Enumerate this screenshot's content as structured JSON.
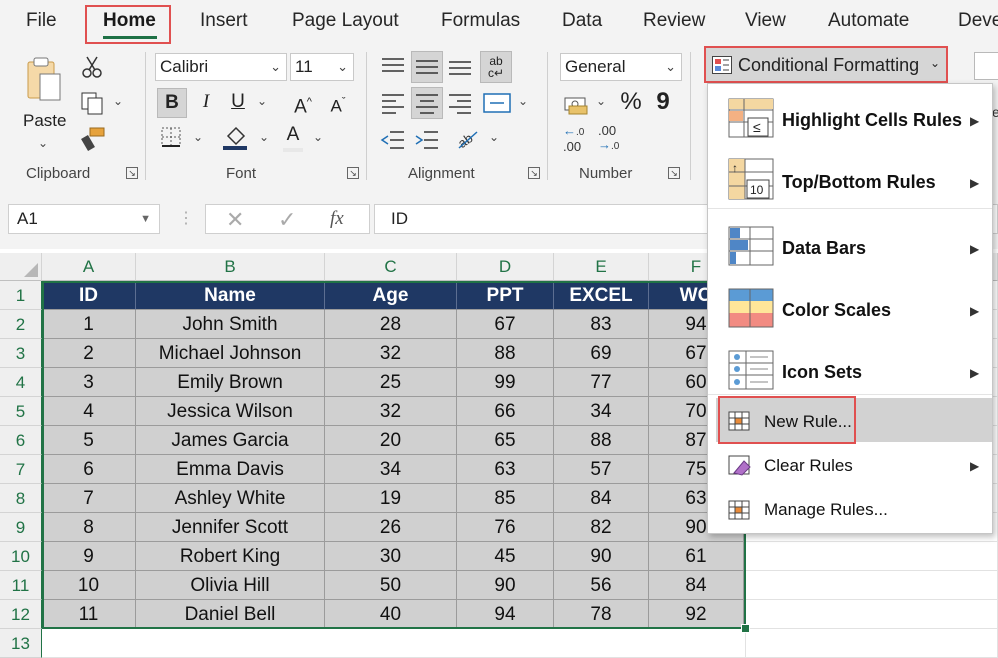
{
  "menu": {
    "tabs": [
      "File",
      "Home",
      "Insert",
      "Page Layout",
      "Formulas",
      "Data",
      "Review",
      "View",
      "Automate",
      "Deve"
    ],
    "active_tab": "Home"
  },
  "ribbon": {
    "clipboard": {
      "paste_label": "Paste",
      "group_label": "Clipboard"
    },
    "font": {
      "font_name": "Calibri",
      "font_size": "11",
      "bold": "B",
      "italic": "I",
      "underline": "U",
      "grow": "A",
      "shrink": "A",
      "font_color": "A",
      "group_label": "Font"
    },
    "alignment": {
      "group_label": "Alignment"
    },
    "number": {
      "format": "General",
      "percent": "%",
      "comma": "9",
      "inc_decimal": ".00",
      "dec_decimal": ".00",
      "group_label": "Number"
    },
    "conditional_formatting": {
      "label": "Conditional Formatting"
    }
  },
  "formula_bar": {
    "name_box": "A1",
    "fx": "fx",
    "content": "ID"
  },
  "sheet": {
    "columns": [
      "A",
      "B",
      "C",
      "D",
      "E",
      "F"
    ],
    "row_numbers": [
      "1",
      "2",
      "3",
      "4",
      "5",
      "6",
      "7",
      "8",
      "9",
      "10",
      "11",
      "12",
      "13"
    ],
    "headers": [
      "ID",
      "Name",
      "Age",
      "PPT",
      "EXCEL",
      "WO"
    ],
    "rows": [
      [
        "1",
        "John Smith",
        "28",
        "67",
        "83",
        "94"
      ],
      [
        "2",
        "Michael Johnson",
        "32",
        "88",
        "69",
        "67"
      ],
      [
        "3",
        "Emily Brown",
        "25",
        "99",
        "77",
        "60"
      ],
      [
        "4",
        "Jessica Wilson",
        "32",
        "66",
        "34",
        "70"
      ],
      [
        "5",
        "James Garcia",
        "20",
        "65",
        "88",
        "87"
      ],
      [
        "6",
        "Emma Davis",
        "34",
        "63",
        "57",
        "75"
      ],
      [
        "7",
        "Ashley White",
        "19",
        "85",
        "84",
        "63"
      ],
      [
        "8",
        "Jennifer Scott",
        "26",
        "76",
        "82",
        "90"
      ],
      [
        "9",
        "Robert King",
        "30",
        "45",
        "90",
        "61"
      ],
      [
        "10",
        "Olivia Hill",
        "50",
        "90",
        "56",
        "84"
      ],
      [
        "11",
        "Daniel Bell",
        "40",
        "94",
        "78",
        "92"
      ]
    ],
    "header_fill": "#1f3864",
    "body_fill": "#d0d0d0"
  },
  "cf_menu": {
    "items": [
      {
        "label": "Highlight Cells Rules",
        "submenu": true
      },
      {
        "label": "Top/Bottom Rules",
        "submenu": true
      },
      {
        "label": "Data Bars",
        "submenu": true
      },
      {
        "label": "Color Scales",
        "submenu": true
      },
      {
        "label": "Icon Sets",
        "submenu": true
      },
      {
        "label": "New Rule...",
        "submenu": false
      },
      {
        "label": "Clear Rules",
        "submenu": true
      },
      {
        "label": "Manage Rules...",
        "submenu": false
      }
    ],
    "highlighted_item": "New Rule..."
  },
  "colors": {
    "accent_red": "#e05050",
    "excel_green": "#217346"
  }
}
